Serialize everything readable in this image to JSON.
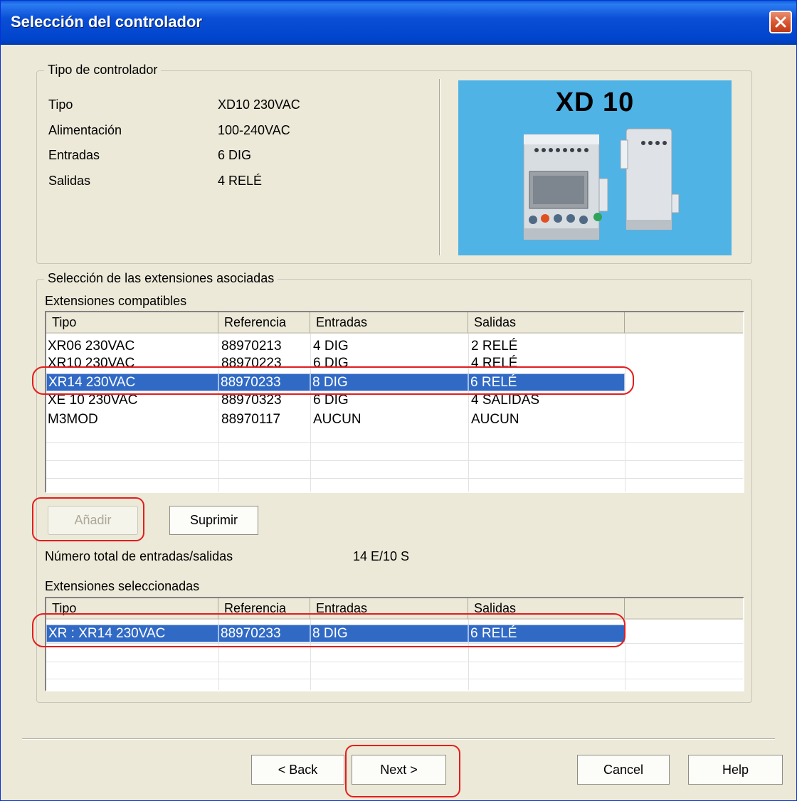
{
  "window": {
    "title": "Selección del controlador"
  },
  "controller_group": {
    "legend": "Tipo de controlador",
    "rows": [
      {
        "label": "Tipo",
        "value": "XD10 230VAC"
      },
      {
        "label": "Alimentación",
        "value": "100-240VAC"
      },
      {
        "label": "Entradas",
        "value": "6 DIG"
      },
      {
        "label": "Salidas",
        "value": "4 RELÉ"
      }
    ],
    "product_image": {
      "title": "XD 10",
      "background": "#4fb3e6"
    }
  },
  "extensions_group": {
    "legend": "Selección de las extensiones asociadas",
    "compatible_label": "Extensiones compatibles",
    "compatible_table": {
      "columns": [
        "Tipo",
        "Referencia",
        "Entradas",
        "Salidas"
      ],
      "rows": [
        [
          "XR06 230VAC",
          "88970213",
          "4 DIG",
          "2 RELÉ"
        ],
        [
          "XR10 230VAC",
          "88970223",
          "6 DIG",
          "4 RELÉ"
        ],
        [
          "XR14 230VAC",
          "88970233",
          "8 DIG",
          "6 RELÉ"
        ],
        [
          "XE 10 230VAC",
          "88970323",
          "6 DIG",
          "4 SALIDAS"
        ],
        [
          "M3MOD",
          "88970117",
          "AUCUN",
          "AUCUN"
        ]
      ],
      "selected_index": 2
    },
    "add_button": "Añadir",
    "remove_button": "Suprimir",
    "total_label": "Número total de entradas/salidas",
    "total_value": "14 E/10 S",
    "selected_label": "Extensiones seleccionadas",
    "selected_table": {
      "columns": [
        "Tipo",
        "Referencia",
        "Entradas",
        "Salidas"
      ],
      "rows": [
        [
          "XR : XR14 230VAC",
          "88970233",
          "8 DIG",
          "6 RELÉ"
        ]
      ],
      "selected_index": 0
    }
  },
  "footer": {
    "back_button": "< Back",
    "next_button": "Next >",
    "cancel_button": "Cancel",
    "help_button": "Help"
  },
  "colors": {
    "titlebar": "#0a4fd6",
    "selection": "#316ac5",
    "highlight_ring": "#e41d1d",
    "dialog_bg": "#ece9d8"
  }
}
